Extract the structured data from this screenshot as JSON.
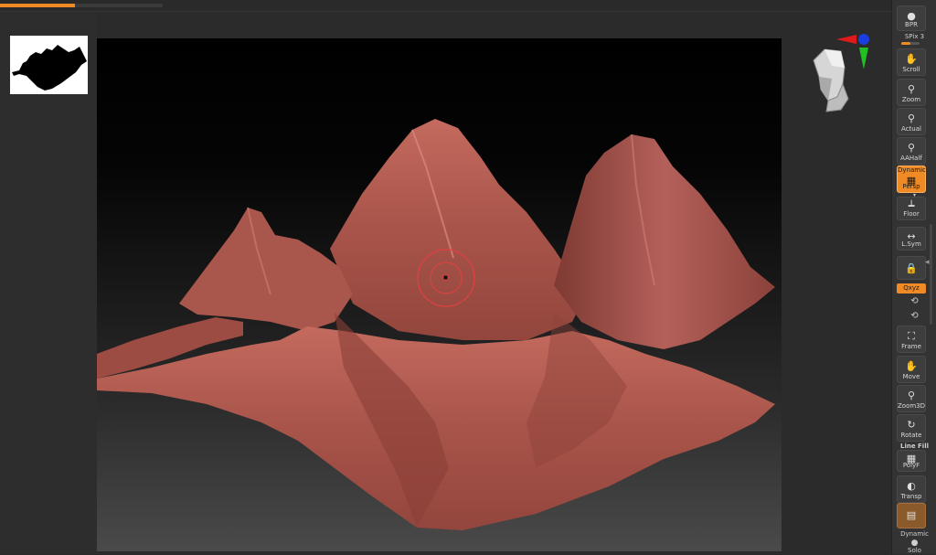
{
  "topbar": {
    "progress": 0.46
  },
  "colors": {
    "accent": "#f08a24",
    "mesh": "#b0584e",
    "background": "#2b2b2b"
  },
  "shelf": {
    "bpr": "BPR",
    "spix": "SPix 3",
    "scroll": "Scroll",
    "zoom": "Zoom",
    "actual": "Actual",
    "aahalf": "AAHalf",
    "dynamic_top": "Dynamic",
    "persp": "Persp",
    "floor": "Floor",
    "lsym": "L.Sym",
    "qxyz": "Qxyz",
    "frame": "Frame",
    "move": "Move",
    "zoom3d": "Zoom3D",
    "rotate": "Rotate",
    "linefill": "Line Fill",
    "polyf": "PolyF",
    "transp": "Transp",
    "dynamic": "Dynamic",
    "solo": "Solo"
  },
  "icons": {
    "bpr": "sphere-icon",
    "scroll": "hand-icon",
    "zoom": "magnifier-icon",
    "actual": "magnifier-icon",
    "aahalf": "magnifier-icon",
    "persp": "perspective-grid-icon",
    "floor": "floor-icon",
    "lsym": "symmetry-icon",
    "lock": "lock-icon",
    "frame": "frame-icon",
    "move": "hand-icon",
    "zoom3d": "magnifier-icon",
    "rotate": "rotate-icon",
    "polyf": "polyframe-grid-icon",
    "transp": "transparency-icon",
    "solo": "solo-icon"
  }
}
